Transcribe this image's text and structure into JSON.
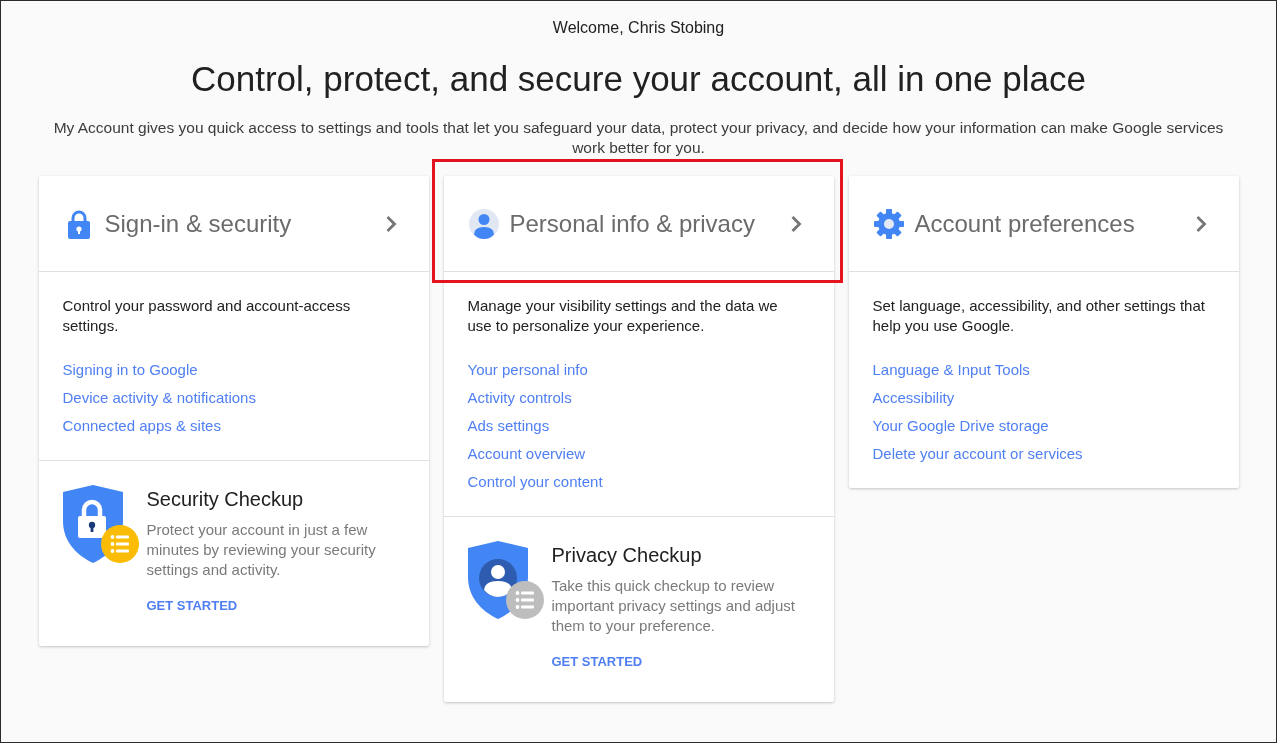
{
  "header": {
    "welcome": "Welcome, Chris Stobing",
    "title": "Control, protect, and secure your account, all in one place",
    "subtitle": "My Account gives you quick access to settings and tools that let you safeguard your data, protect your privacy, and decide how your information can make Google services work better for you."
  },
  "cards": [
    {
      "kind": "security",
      "title": "Sign-in & security",
      "highlighted": false,
      "description": "Control your password and account-access settings.",
      "links": [
        "Signing in to Google",
        "Device activity & notifications",
        "Connected apps & sites"
      ],
      "checkup": {
        "title": "Security Checkup",
        "description": "Protect your account in just a few minutes by reviewing your security settings and activity.",
        "action": "GET STARTED"
      }
    },
    {
      "kind": "privacy",
      "title": "Personal info & privacy",
      "highlighted": true,
      "description": "Manage your visibility settings and the data we use to personalize your experience.",
      "links": [
        "Your personal info",
        "Activity controls",
        "Ads settings",
        "Account overview",
        "Control your content"
      ],
      "checkup": {
        "title": "Privacy Checkup",
        "description": "Take this quick checkup to review important privacy settings and adjust them to your preference.",
        "action": "GET STARTED"
      }
    },
    {
      "kind": "preferences",
      "title": "Account preferences",
      "highlighted": false,
      "description": "Set language, accessibility, and other settings that help you use Google.",
      "links": [
        "Language & Input Tools",
        "Accessibility",
        "Your Google Drive storage",
        "Delete your account or services"
      ]
    }
  ]
}
